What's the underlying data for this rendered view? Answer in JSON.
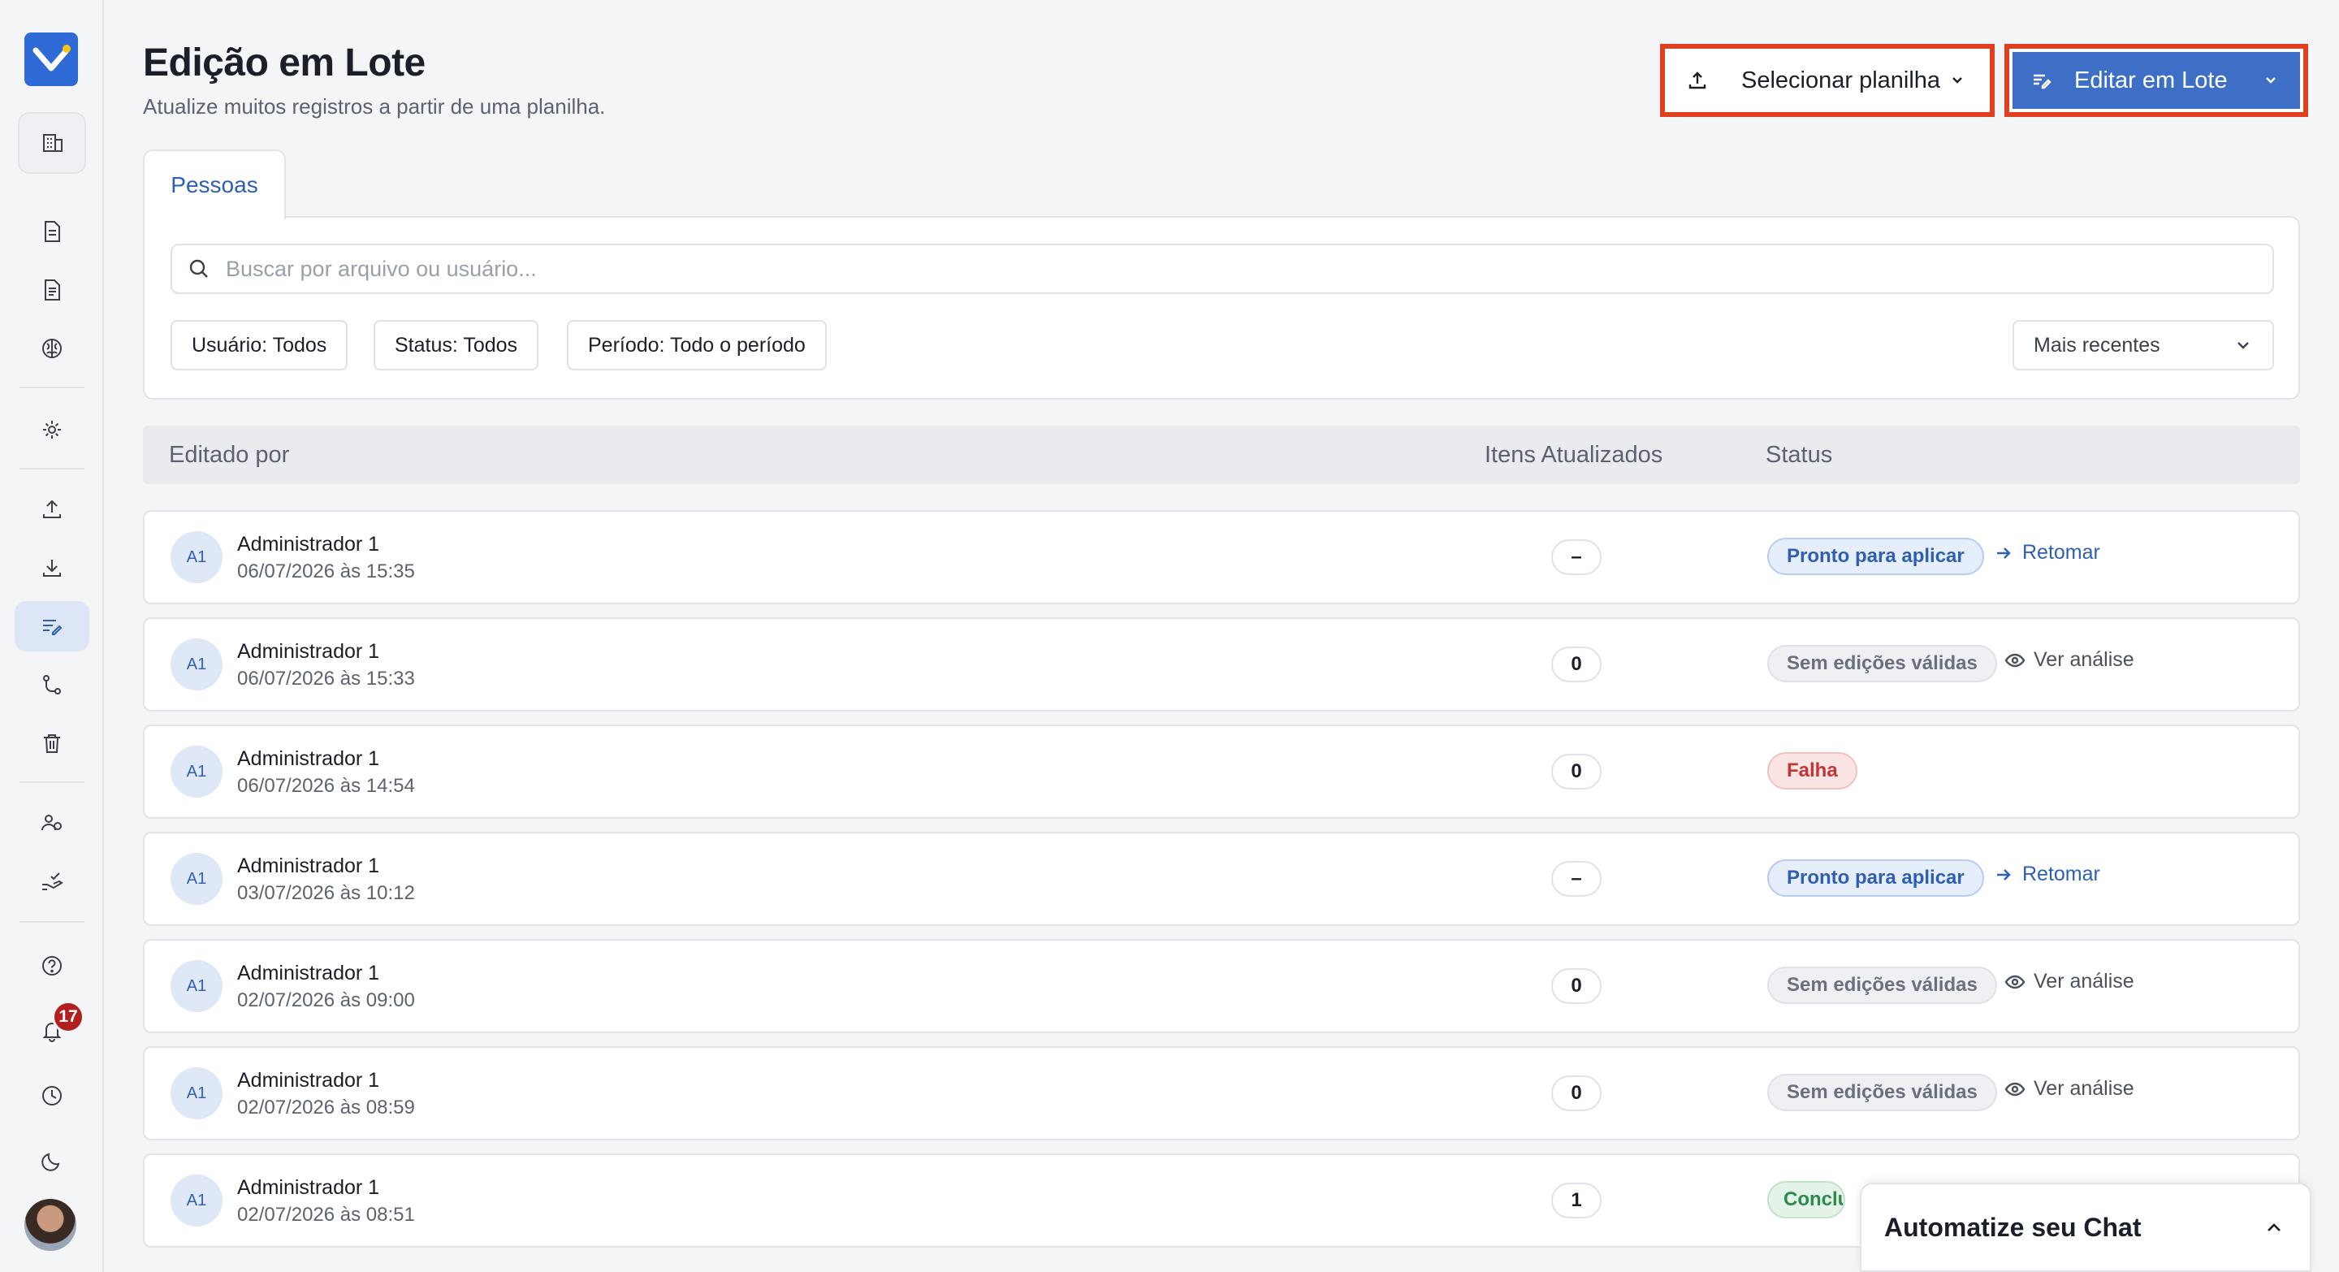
{
  "page": {
    "title": "Edição em Lote",
    "subtitle": "Atualize muitos registros a partir de uma planilha."
  },
  "header_actions": {
    "upload_label": "Selecionar planilha",
    "edit_label": "Editar em Lote"
  },
  "tabs": [
    {
      "label": "Pessoas",
      "active": true
    }
  ],
  "search": {
    "placeholder": "Buscar por arquivo ou usuário..."
  },
  "filters": {
    "user": "Usuário: Todos",
    "status": "Status: Todos",
    "period": "Período: Todo o período",
    "sort": "Mais recentes"
  },
  "table": {
    "headers": {
      "edited_by": "Editado por",
      "items_updated": "Itens Atualizados",
      "status": "Status"
    },
    "rows": [
      {
        "initials": "A1",
        "name": "Administrador 1",
        "date": "06/07/2026 às 15:35",
        "count": "–",
        "status": "Pronto para aplicar",
        "status_type": "ready",
        "action": "Retomar",
        "action_type": "resume"
      },
      {
        "initials": "A1",
        "name": "Administrador 1",
        "date": "06/07/2026 às 15:33",
        "count": "0",
        "status": "Sem edições válidas",
        "status_type": "none",
        "action": "Ver análise",
        "action_type": "view"
      },
      {
        "initials": "A1",
        "name": "Administrador 1",
        "date": "06/07/2026 às 14:54",
        "count": "0",
        "status": "Falha",
        "status_type": "fail",
        "action": "",
        "action_type": ""
      },
      {
        "initials": "A1",
        "name": "Administrador 1",
        "date": "03/07/2026 às 10:12",
        "count": "–",
        "status": "Pronto para aplicar",
        "status_type": "ready",
        "action": "Retomar",
        "action_type": "resume"
      },
      {
        "initials": "A1",
        "name": "Administrador 1",
        "date": "02/07/2026 às 09:00",
        "count": "0",
        "status": "Sem edições válidas",
        "status_type": "none",
        "action": "Ver análise",
        "action_type": "view"
      },
      {
        "initials": "A1",
        "name": "Administrador 1",
        "date": "02/07/2026 às 08:59",
        "count": "0",
        "status": "Sem edições válidas",
        "status_type": "none",
        "action": "Ver análise",
        "action_type": "view"
      },
      {
        "initials": "A1",
        "name": "Administrador 1",
        "date": "02/07/2026 às 08:51",
        "count": "1",
        "status": "Concluí",
        "status_type": "done",
        "action": "",
        "action_type": ""
      }
    ]
  },
  "sidebar": {
    "notification_count": "17"
  },
  "chat_widget": {
    "label": "Automatize seu Chat"
  },
  "colors": {
    "accent": "#3d6fc6",
    "highlight": "#e04020",
    "fail": "#c43434",
    "success": "#2e8a4d"
  },
  "icons": [
    "building-icon",
    "document-icon",
    "document-lines-icon",
    "brain-icon",
    "gear-icon",
    "upload-icon",
    "download-icon",
    "batch-edit-icon",
    "flow-icon",
    "trash-icon",
    "users-icon",
    "hand-check-icon",
    "help-icon",
    "bell-icon",
    "clock-icon",
    "moon-icon"
  ]
}
